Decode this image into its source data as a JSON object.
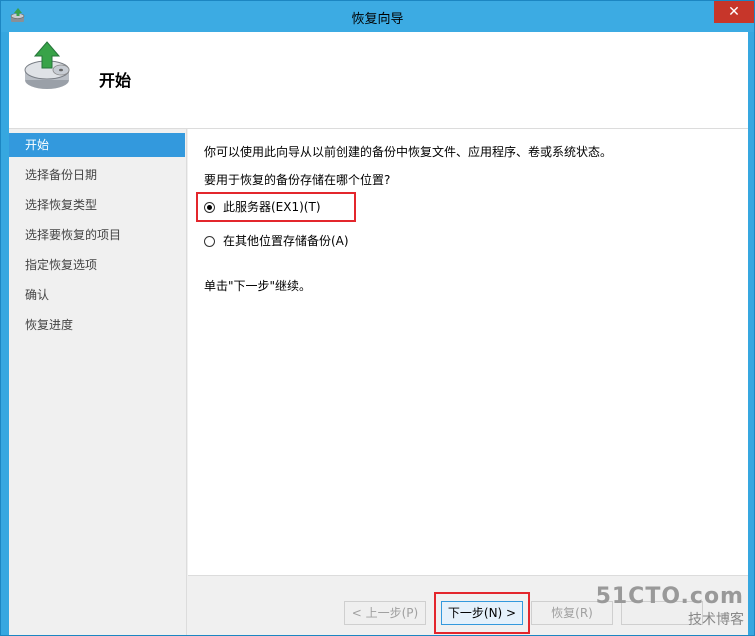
{
  "window": {
    "title": "恢复向导",
    "close_glyph": "✕"
  },
  "header": {
    "title": "开始",
    "icon": "backup-restore-icon"
  },
  "sidebar": {
    "items": [
      {
        "label": "开始",
        "active": true
      },
      {
        "label": "选择备份日期"
      },
      {
        "label": "选择恢复类型"
      },
      {
        "label": "选择要恢复的项目"
      },
      {
        "label": "指定恢复选项"
      },
      {
        "label": "确认"
      },
      {
        "label": "恢复进度"
      }
    ]
  },
  "content": {
    "intro": "你可以使用此向导从以前创建的备份中恢复文件、应用程序、卷或系统状态。",
    "question": "要用于恢复的备份存储在哪个位置?",
    "options": [
      {
        "label": "此服务器(EX1)(T)",
        "checked": true
      },
      {
        "label": "在其他位置存储备份(A)",
        "checked": false
      }
    ],
    "hint": "单击\"下一步\"继续。"
  },
  "footer": {
    "prev_label": "< 上一步(P)",
    "next_label": "下一步(N) >",
    "restore_label": "恢复(R)"
  },
  "watermark": {
    "line1": "51CTO.com",
    "line2": "技术博客"
  },
  "colors": {
    "accent": "#3399dd",
    "highlight": "#e3262c",
    "title_bar": "#3cabe3"
  }
}
